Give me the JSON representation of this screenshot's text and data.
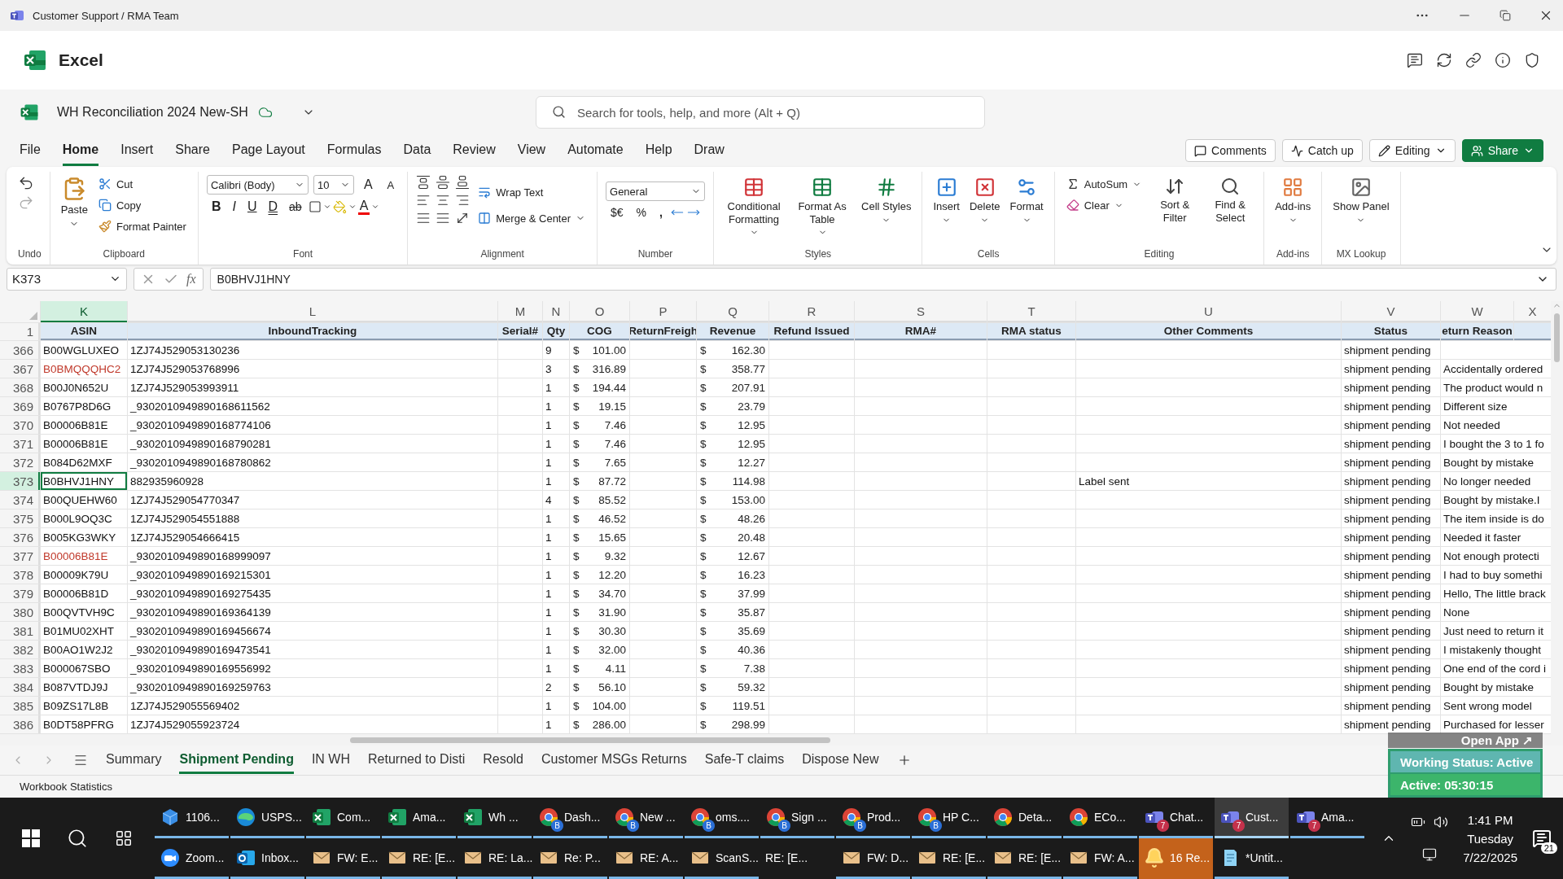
{
  "title_bar": {
    "title": "Customer Support / RMA Team"
  },
  "app_header": {
    "name": "Excel"
  },
  "document": {
    "title": "WH Reconciliation 2024 New-SH"
  },
  "search": {
    "placeholder": "Search for tools, help, and more (Alt + Q)"
  },
  "menu_tabs": [
    {
      "label": "File",
      "selected": false
    },
    {
      "label": "Home",
      "selected": true
    },
    {
      "label": "Insert",
      "selected": false
    },
    {
      "label": "Share",
      "selected": false
    },
    {
      "label": "Page Layout",
      "selected": false
    },
    {
      "label": "Formulas",
      "selected": false
    },
    {
      "label": "Data",
      "selected": false
    },
    {
      "label": "Review",
      "selected": false
    },
    {
      "label": "View",
      "selected": false
    },
    {
      "label": "Automate",
      "selected": false
    },
    {
      "label": "Help",
      "selected": false
    },
    {
      "label": "Draw",
      "selected": false
    }
  ],
  "header_buttons": [
    {
      "kind": "comments",
      "label": "Comments"
    },
    {
      "kind": "catchup",
      "label": "Catch up"
    },
    {
      "kind": "editing",
      "label": "Editing"
    },
    {
      "kind": "share",
      "label": "Share"
    }
  ],
  "ribbon": [
    {
      "kind": "undo",
      "label": "Undo"
    },
    {
      "kind": "clipboard",
      "label": "Clipboard",
      "large": "Paste",
      "small": [
        "Cut",
        "Copy",
        "Format Painter"
      ]
    },
    {
      "kind": "font",
      "label": "Font",
      "font": "Calibri (Body)",
      "size": "10",
      "grow": "A",
      "shrink": "A",
      "styles": [
        "B",
        "I",
        "U",
        "D",
        "ab"
      ],
      "font_color": "A"
    },
    {
      "kind": "alignment",
      "label": "Alignment",
      "commands": [
        "Wrap Text",
        "Merge & Center"
      ]
    },
    {
      "kind": "number",
      "label": "Number",
      "format": "General",
      "symbols": [
        "$€",
        "%",
        ","
      ]
    },
    {
      "kind": "large",
      "label": "Styles",
      "buttons": [
        "Conditional Formatting",
        "Format As Table",
        "Cell Styles"
      ]
    },
    {
      "kind": "large",
      "label": "Cells",
      "buttons": [
        "Insert",
        "Delete",
        "Format"
      ]
    },
    {
      "kind": "editing",
      "label": "Editing",
      "small": [
        "AutoSum",
        "Clear"
      ],
      "large": [
        "Sort & Filter",
        "Find & Select"
      ]
    },
    {
      "kind": "large",
      "label": "Add-ins",
      "buttons": [
        "Add-ins"
      ]
    },
    {
      "kind": "large",
      "label": "MX Lookup",
      "buttons": [
        "Show Panel"
      ]
    }
  ],
  "formula_bar": {
    "name_box": "K373",
    "function_label": "fx",
    "formula": "B0BHVJ1HNY"
  },
  "columns": [
    {
      "letter": "K",
      "label": "ASIN",
      "selected": true
    },
    {
      "letter": "L",
      "label": "InboundTracking",
      "selected": false
    },
    {
      "letter": "M",
      "label": "Serial#",
      "selected": false
    },
    {
      "letter": "N",
      "label": "Qty",
      "selected": false
    },
    {
      "letter": "O",
      "label": "COG",
      "selected": false
    },
    {
      "letter": "P",
      "label": "ReturnFreigh",
      "selected": false
    },
    {
      "letter": "Q",
      "label": "Revenue",
      "selected": false
    },
    {
      "letter": "R",
      "label": "Refund Issued",
      "selected": false
    },
    {
      "letter": "S",
      "label": "RMA#",
      "selected": false
    },
    {
      "letter": "T",
      "label": "RMA status",
      "selected": false
    },
    {
      "letter": "U",
      "label": "Other Comments",
      "selected": false
    },
    {
      "letter": "V",
      "label": "Status",
      "selected": false
    },
    {
      "letter": "W",
      "label": "eturn Reason",
      "selected": false
    },
    {
      "letter": "X",
      "selected": false
    }
  ],
  "header_row_number": "1",
  "rows": [
    {
      "n": "366",
      "selected": false,
      "asin": "B00WGLUXEO",
      "flagged": false,
      "tracking": "1ZJ74J529053130236",
      "qty": "9",
      "cog_currency": "$",
      "cog": "101.00",
      "revenue_currency": "$",
      "revenue": "162.30",
      "status": "shipment pending"
    },
    {
      "n": "367",
      "selected": false,
      "asin": "B0BMQQQHC2",
      "flagged": true,
      "tracking": "1ZJ74J529053768996",
      "qty": "3",
      "cog_currency": "$",
      "cog": "316.89",
      "revenue_currency": "$",
      "revenue": "358.77",
      "status": "shipment pending",
      "reason": "Accidentally ordered"
    },
    {
      "n": "368",
      "selected": false,
      "asin": "B00J0N652U",
      "flagged": false,
      "tracking": "1ZJ74J529053993911",
      "qty": "1",
      "cog_currency": "$",
      "cog": "194.44",
      "revenue_currency": "$",
      "revenue": "207.91",
      "status": "shipment pending",
      "reason": "The product would n"
    },
    {
      "n": "369",
      "selected": false,
      "asin": "B0767P8D6G",
      "flagged": false,
      "tracking": "_9302010949890168611562",
      "qty": "1",
      "cog_currency": "$",
      "cog": "19.15",
      "revenue_currency": "$",
      "revenue": "23.79",
      "status": "shipment pending",
      "reason": "Different size"
    },
    {
      "n": "370",
      "selected": false,
      "asin": "B00006B81E",
      "flagged": false,
      "tracking": "_9302010949890168774106",
      "qty": "1",
      "cog_currency": "$",
      "cog": "7.46",
      "revenue_currency": "$",
      "revenue": "12.95",
      "status": "shipment pending",
      "reason": "Not needed"
    },
    {
      "n": "371",
      "selected": false,
      "asin": "B00006B81E",
      "flagged": false,
      "tracking": "_9302010949890168790281",
      "qty": "1",
      "cog_currency": "$",
      "cog": "7.46",
      "revenue_currency": "$",
      "revenue": "12.95",
      "status": "shipment pending",
      "reason": "I bought the 3 to 1 fo"
    },
    {
      "n": "372",
      "selected": false,
      "asin": "B084D62MXF",
      "flagged": false,
      "tracking": "_9302010949890168780862",
      "qty": "1",
      "cog_currency": "$",
      "cog": "7.65",
      "revenue_currency": "$",
      "revenue": "12.27",
      "status": "shipment pending",
      "reason": "Bought by mistake"
    },
    {
      "n": "373",
      "selected": true,
      "asin": "B0BHVJ1HNY",
      "flagged": false,
      "tracking": "882935960928",
      "qty": "1",
      "cog_currency": "$",
      "cog": "87.72",
      "revenue_currency": "$",
      "revenue": "114.98",
      "comments": "Label sent",
      "status": "shipment pending",
      "reason": "No longer needed"
    },
    {
      "n": "374",
      "selected": false,
      "asin": "B00QUEHW60",
      "flagged": false,
      "tracking": "1ZJ74J529054770347",
      "qty": "4",
      "cog_currency": "$",
      "cog": "85.52",
      "revenue_currency": "$",
      "revenue": "153.00",
      "status": "shipment pending",
      "reason": "Bought by mistake.I"
    },
    {
      "n": "375",
      "selected": false,
      "asin": "B000L9OQ3C",
      "flagged": false,
      "tracking": "1ZJ74J529054551888",
      "qty": "1",
      "cog_currency": "$",
      "cog": "46.52",
      "revenue_currency": "$",
      "revenue": "48.26",
      "status": "shipment pending",
      "reason": "The item inside is do"
    },
    {
      "n": "376",
      "selected": false,
      "asin": "B005KG3WKY",
      "flagged": false,
      "tracking": "1ZJ74J529054666415",
      "qty": "1",
      "cog_currency": "$",
      "cog": "15.65",
      "revenue_currency": "$",
      "revenue": "20.48",
      "status": "shipment pending",
      "reason": "Needed it faster"
    },
    {
      "n": "377",
      "selected": false,
      "asin": "B00006B81E",
      "flagged": true,
      "tracking": "_9302010949890168999097",
      "qty": "1",
      "cog_currency": "$",
      "cog": "9.32",
      "revenue_currency": "$",
      "revenue": "12.67",
      "status": "shipment pending",
      "reason": "Not enough protecti"
    },
    {
      "n": "378",
      "selected": false,
      "asin": "B00009K79U",
      "flagged": false,
      "tracking": "_9302010949890169215301",
      "qty": "1",
      "cog_currency": "$",
      "cog": "12.20",
      "revenue_currency": "$",
      "revenue": "16.23",
      "status": "shipment pending",
      "reason": "I had to buy somethi"
    },
    {
      "n": "379",
      "selected": false,
      "asin": "B00006B81D",
      "flagged": false,
      "tracking": "_9302010949890169275435",
      "qty": "1",
      "cog_currency": "$",
      "cog": "34.70",
      "revenue_currency": "$",
      "revenue": "37.99",
      "status": "shipment pending",
      "reason": "Hello, The little brack"
    },
    {
      "n": "380",
      "selected": false,
      "asin": "B00QVTVH9C",
      "flagged": false,
      "tracking": "_9302010949890169364139",
      "qty": "1",
      "cog_currency": "$",
      "cog": "31.90",
      "revenue_currency": "$",
      "revenue": "35.87",
      "status": "shipment pending",
      "reason": "None"
    },
    {
      "n": "381",
      "selected": false,
      "asin": "B01MU02XHT",
      "flagged": false,
      "tracking": "_9302010949890169456674",
      "qty": "1",
      "cog_currency": "$",
      "cog": "30.30",
      "revenue_currency": "$",
      "revenue": "35.69",
      "status": "shipment pending",
      "reason": "Just need to return it"
    },
    {
      "n": "382",
      "selected": false,
      "asin": "B00AO1W2J2",
      "flagged": false,
      "tracking": "_9302010949890169473541",
      "qty": "1",
      "cog_currency": "$",
      "cog": "32.00",
      "revenue_currency": "$",
      "revenue": "40.36",
      "status": "shipment pending",
      "reason": "I mistakenly thought"
    },
    {
      "n": "383",
      "selected": false,
      "asin": "B000067SBO",
      "flagged": false,
      "tracking": "_9302010949890169556992",
      "qty": "1",
      "cog_currency": "$",
      "cog": "4.11",
      "revenue_currency": "$",
      "revenue": "7.38",
      "status": "shipment pending",
      "reason": "One end of the cord i"
    },
    {
      "n": "384",
      "selected": false,
      "asin": "B087VTDJ9J",
      "flagged": false,
      "tracking": "_9302010949890169259763",
      "qty": "2",
      "cog_currency": "$",
      "cog": "56.10",
      "revenue_currency": "$",
      "revenue": "59.32",
      "status": "shipment pending",
      "reason": "Bought by mistake"
    },
    {
      "n": "385",
      "selected": false,
      "asin": "B09ZS17L8B",
      "flagged": false,
      "tracking": "1ZJ74J529055569402",
      "qty": "1",
      "cog_currency": "$",
      "cog": "104.00",
      "revenue_currency": "$",
      "revenue": "119.51",
      "status": "shipment pending",
      "reason": "Sent wrong model"
    },
    {
      "n": "386",
      "selected": false,
      "asin": "B0DT58PFRG",
      "flagged": false,
      "tracking": "1ZJ74J529055923724",
      "qty": "1",
      "cog_currency": "$",
      "cog": "286.00",
      "revenue_currency": "$",
      "revenue": "298.99",
      "status": "shipment pending",
      "reason": "Purchased for lesser"
    }
  ],
  "sheet_tabs": [
    {
      "label": "Summary",
      "selected": false
    },
    {
      "label": "Shipment Pending",
      "selected": true
    },
    {
      "label": "IN WH",
      "selected": false
    },
    {
      "label": "Returned to Disti",
      "selected": false
    },
    {
      "label": "Resold",
      "selected": false
    },
    {
      "label": "Customer MSGs Returns",
      "selected": false
    },
    {
      "label": "Safe-T claims",
      "selected": false
    },
    {
      "label": "Dispose New",
      "selected": false
    }
  ],
  "status_bar": {
    "label": "Workbook Statistics"
  },
  "open_app": {
    "label": "Open App ↗"
  },
  "work_status": {
    "status": "Working Status: Active",
    "timer": "Active: 05:30:15"
  },
  "taskbar": {
    "rows": [
      [
        {
          "kind": "app",
          "label": "1106...",
          "selected": false
        },
        {
          "kind": "edge",
          "label": "USPS...",
          "selected": false
        },
        {
          "kind": "excel",
          "label": "Com...",
          "selected": false
        },
        {
          "kind": "excel",
          "label": "Ama...",
          "selected": false
        },
        {
          "kind": "excel",
          "label": "Wh ...",
          "selected": false
        },
        {
          "kind": "chrome",
          "label": "Dash...",
          "badge": "B",
          "selected": false
        },
        {
          "kind": "chrome",
          "label": "New ...",
          "badge": "B",
          "selected": false
        },
        {
          "kind": "chrome",
          "label": "oms....",
          "badge": "B",
          "selected": false
        },
        {
          "kind": "chrome",
          "label": "Sign ...",
          "badge": "B",
          "selected": false
        },
        {
          "kind": "chrome",
          "label": "Prod...",
          "badge": "B",
          "selected": false
        },
        {
          "kind": "chrome",
          "label": "HP C...",
          "badge": "B",
          "selected": false
        },
        {
          "kind": "chrome",
          "label": "Deta...",
          "selected": false
        },
        {
          "kind": "chrome",
          "label": "ECo...",
          "selected": false
        },
        {
          "kind": "teams",
          "label": "Chat...",
          "badge": "7",
          "selected": false
        },
        {
          "kind": "teams",
          "label": "Cust...",
          "badge": "7",
          "selected": true
        },
        {
          "kind": "teams",
          "label": "Ama...",
          "badge": "7",
          "selected": false
        }
      ],
      [
        {
          "kind": "zoom",
          "label": "Zoom...",
          "selected": false
        },
        {
          "kind": "outlook",
          "label": "Inbox...",
          "selected": false
        },
        {
          "kind": "mail",
          "label": "FW: E...",
          "selected": false
        },
        {
          "kind": "mail",
          "label": "RE: [E...",
          "selected": false
        },
        {
          "kind": "mail",
          "label": "RE: La...",
          "selected": false
        },
        {
          "kind": "mail",
          "label": "Re: P...",
          "selected": false
        },
        {
          "kind": "mail",
          "label": "RE: A...",
          "selected": false
        },
        {
          "kind": "mail",
          "label": "ScanS...",
          "selected": false
        },
        {
          "kind": "plain",
          "label": "RE: [E...",
          "selected": false
        },
        {
          "kind": "mail",
          "label": "FW: D...",
          "selected": false
        },
        {
          "kind": "mail",
          "label": "RE: [E...",
          "selected": false
        },
        {
          "kind": "mail",
          "label": "RE: [E...",
          "selected": false
        },
        {
          "kind": "mail",
          "label": "FW: A...",
          "selected": false
        },
        {
          "kind": "reminder",
          "label": "16 Re...",
          "selected": false
        },
        {
          "kind": "notepad",
          "label": "*Untit...",
          "selected": false
        }
      ]
    ],
    "time": "1:41 PM",
    "day": "Tuesday",
    "date": "7/22/2025",
    "notifications": "21"
  }
}
